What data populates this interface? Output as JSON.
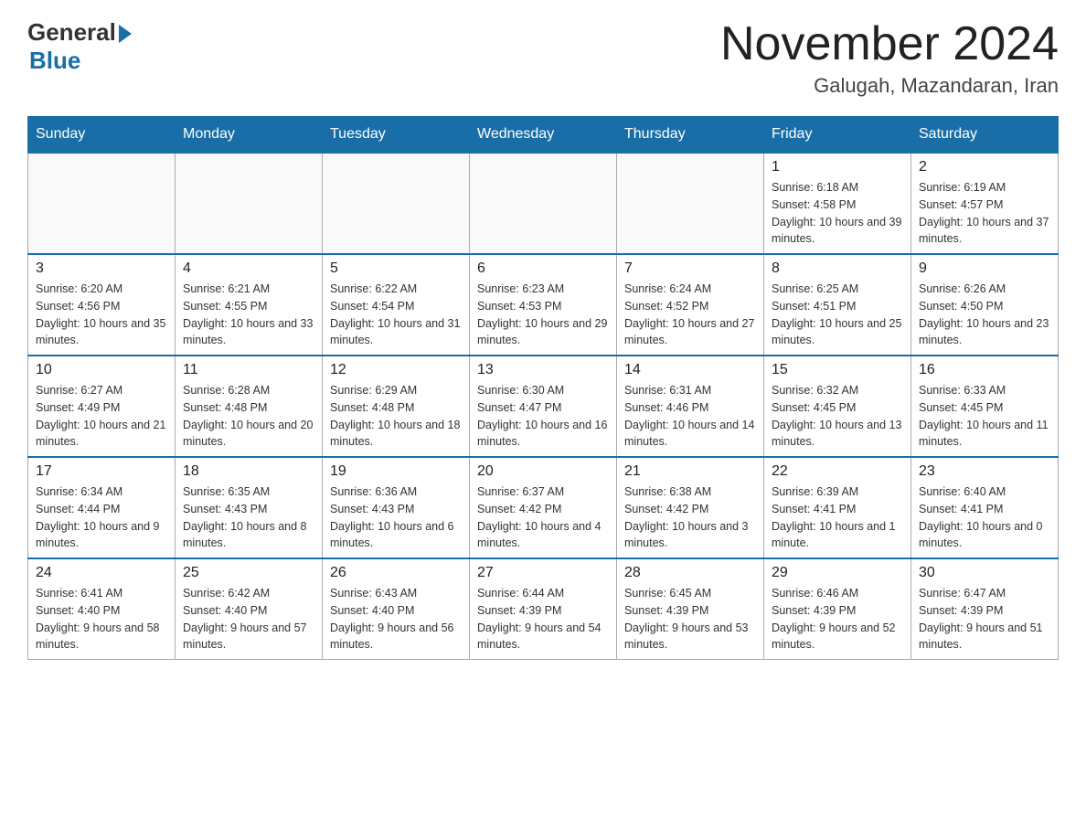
{
  "header": {
    "logo_general": "General",
    "logo_blue": "Blue",
    "month_title": "November 2024",
    "location": "Galugah, Mazandaran, Iran"
  },
  "weekdays": [
    "Sunday",
    "Monday",
    "Tuesday",
    "Wednesday",
    "Thursday",
    "Friday",
    "Saturday"
  ],
  "weeks": [
    [
      {
        "day": "",
        "sunrise": "",
        "sunset": "",
        "daylight": ""
      },
      {
        "day": "",
        "sunrise": "",
        "sunset": "",
        "daylight": ""
      },
      {
        "day": "",
        "sunrise": "",
        "sunset": "",
        "daylight": ""
      },
      {
        "day": "",
        "sunrise": "",
        "sunset": "",
        "daylight": ""
      },
      {
        "day": "",
        "sunrise": "",
        "sunset": "",
        "daylight": ""
      },
      {
        "day": "1",
        "sunrise": "Sunrise: 6:18 AM",
        "sunset": "Sunset: 4:58 PM",
        "daylight": "Daylight: 10 hours and 39 minutes."
      },
      {
        "day": "2",
        "sunrise": "Sunrise: 6:19 AM",
        "sunset": "Sunset: 4:57 PM",
        "daylight": "Daylight: 10 hours and 37 minutes."
      }
    ],
    [
      {
        "day": "3",
        "sunrise": "Sunrise: 6:20 AM",
        "sunset": "Sunset: 4:56 PM",
        "daylight": "Daylight: 10 hours and 35 minutes."
      },
      {
        "day": "4",
        "sunrise": "Sunrise: 6:21 AM",
        "sunset": "Sunset: 4:55 PM",
        "daylight": "Daylight: 10 hours and 33 minutes."
      },
      {
        "day": "5",
        "sunrise": "Sunrise: 6:22 AM",
        "sunset": "Sunset: 4:54 PM",
        "daylight": "Daylight: 10 hours and 31 minutes."
      },
      {
        "day": "6",
        "sunrise": "Sunrise: 6:23 AM",
        "sunset": "Sunset: 4:53 PM",
        "daylight": "Daylight: 10 hours and 29 minutes."
      },
      {
        "day": "7",
        "sunrise": "Sunrise: 6:24 AM",
        "sunset": "Sunset: 4:52 PM",
        "daylight": "Daylight: 10 hours and 27 minutes."
      },
      {
        "day": "8",
        "sunrise": "Sunrise: 6:25 AM",
        "sunset": "Sunset: 4:51 PM",
        "daylight": "Daylight: 10 hours and 25 minutes."
      },
      {
        "day": "9",
        "sunrise": "Sunrise: 6:26 AM",
        "sunset": "Sunset: 4:50 PM",
        "daylight": "Daylight: 10 hours and 23 minutes."
      }
    ],
    [
      {
        "day": "10",
        "sunrise": "Sunrise: 6:27 AM",
        "sunset": "Sunset: 4:49 PM",
        "daylight": "Daylight: 10 hours and 21 minutes."
      },
      {
        "day": "11",
        "sunrise": "Sunrise: 6:28 AM",
        "sunset": "Sunset: 4:48 PM",
        "daylight": "Daylight: 10 hours and 20 minutes."
      },
      {
        "day": "12",
        "sunrise": "Sunrise: 6:29 AM",
        "sunset": "Sunset: 4:48 PM",
        "daylight": "Daylight: 10 hours and 18 minutes."
      },
      {
        "day": "13",
        "sunrise": "Sunrise: 6:30 AM",
        "sunset": "Sunset: 4:47 PM",
        "daylight": "Daylight: 10 hours and 16 minutes."
      },
      {
        "day": "14",
        "sunrise": "Sunrise: 6:31 AM",
        "sunset": "Sunset: 4:46 PM",
        "daylight": "Daylight: 10 hours and 14 minutes."
      },
      {
        "day": "15",
        "sunrise": "Sunrise: 6:32 AM",
        "sunset": "Sunset: 4:45 PM",
        "daylight": "Daylight: 10 hours and 13 minutes."
      },
      {
        "day": "16",
        "sunrise": "Sunrise: 6:33 AM",
        "sunset": "Sunset: 4:45 PM",
        "daylight": "Daylight: 10 hours and 11 minutes."
      }
    ],
    [
      {
        "day": "17",
        "sunrise": "Sunrise: 6:34 AM",
        "sunset": "Sunset: 4:44 PM",
        "daylight": "Daylight: 10 hours and 9 minutes."
      },
      {
        "day": "18",
        "sunrise": "Sunrise: 6:35 AM",
        "sunset": "Sunset: 4:43 PM",
        "daylight": "Daylight: 10 hours and 8 minutes."
      },
      {
        "day": "19",
        "sunrise": "Sunrise: 6:36 AM",
        "sunset": "Sunset: 4:43 PM",
        "daylight": "Daylight: 10 hours and 6 minutes."
      },
      {
        "day": "20",
        "sunrise": "Sunrise: 6:37 AM",
        "sunset": "Sunset: 4:42 PM",
        "daylight": "Daylight: 10 hours and 4 minutes."
      },
      {
        "day": "21",
        "sunrise": "Sunrise: 6:38 AM",
        "sunset": "Sunset: 4:42 PM",
        "daylight": "Daylight: 10 hours and 3 minutes."
      },
      {
        "day": "22",
        "sunrise": "Sunrise: 6:39 AM",
        "sunset": "Sunset: 4:41 PM",
        "daylight": "Daylight: 10 hours and 1 minute."
      },
      {
        "day": "23",
        "sunrise": "Sunrise: 6:40 AM",
        "sunset": "Sunset: 4:41 PM",
        "daylight": "Daylight: 10 hours and 0 minutes."
      }
    ],
    [
      {
        "day": "24",
        "sunrise": "Sunrise: 6:41 AM",
        "sunset": "Sunset: 4:40 PM",
        "daylight": "Daylight: 9 hours and 58 minutes."
      },
      {
        "day": "25",
        "sunrise": "Sunrise: 6:42 AM",
        "sunset": "Sunset: 4:40 PM",
        "daylight": "Daylight: 9 hours and 57 minutes."
      },
      {
        "day": "26",
        "sunrise": "Sunrise: 6:43 AM",
        "sunset": "Sunset: 4:40 PM",
        "daylight": "Daylight: 9 hours and 56 minutes."
      },
      {
        "day": "27",
        "sunrise": "Sunrise: 6:44 AM",
        "sunset": "Sunset: 4:39 PM",
        "daylight": "Daylight: 9 hours and 54 minutes."
      },
      {
        "day": "28",
        "sunrise": "Sunrise: 6:45 AM",
        "sunset": "Sunset: 4:39 PM",
        "daylight": "Daylight: 9 hours and 53 minutes."
      },
      {
        "day": "29",
        "sunrise": "Sunrise: 6:46 AM",
        "sunset": "Sunset: 4:39 PM",
        "daylight": "Daylight: 9 hours and 52 minutes."
      },
      {
        "day": "30",
        "sunrise": "Sunrise: 6:47 AM",
        "sunset": "Sunset: 4:39 PM",
        "daylight": "Daylight: 9 hours and 51 minutes."
      }
    ]
  ]
}
